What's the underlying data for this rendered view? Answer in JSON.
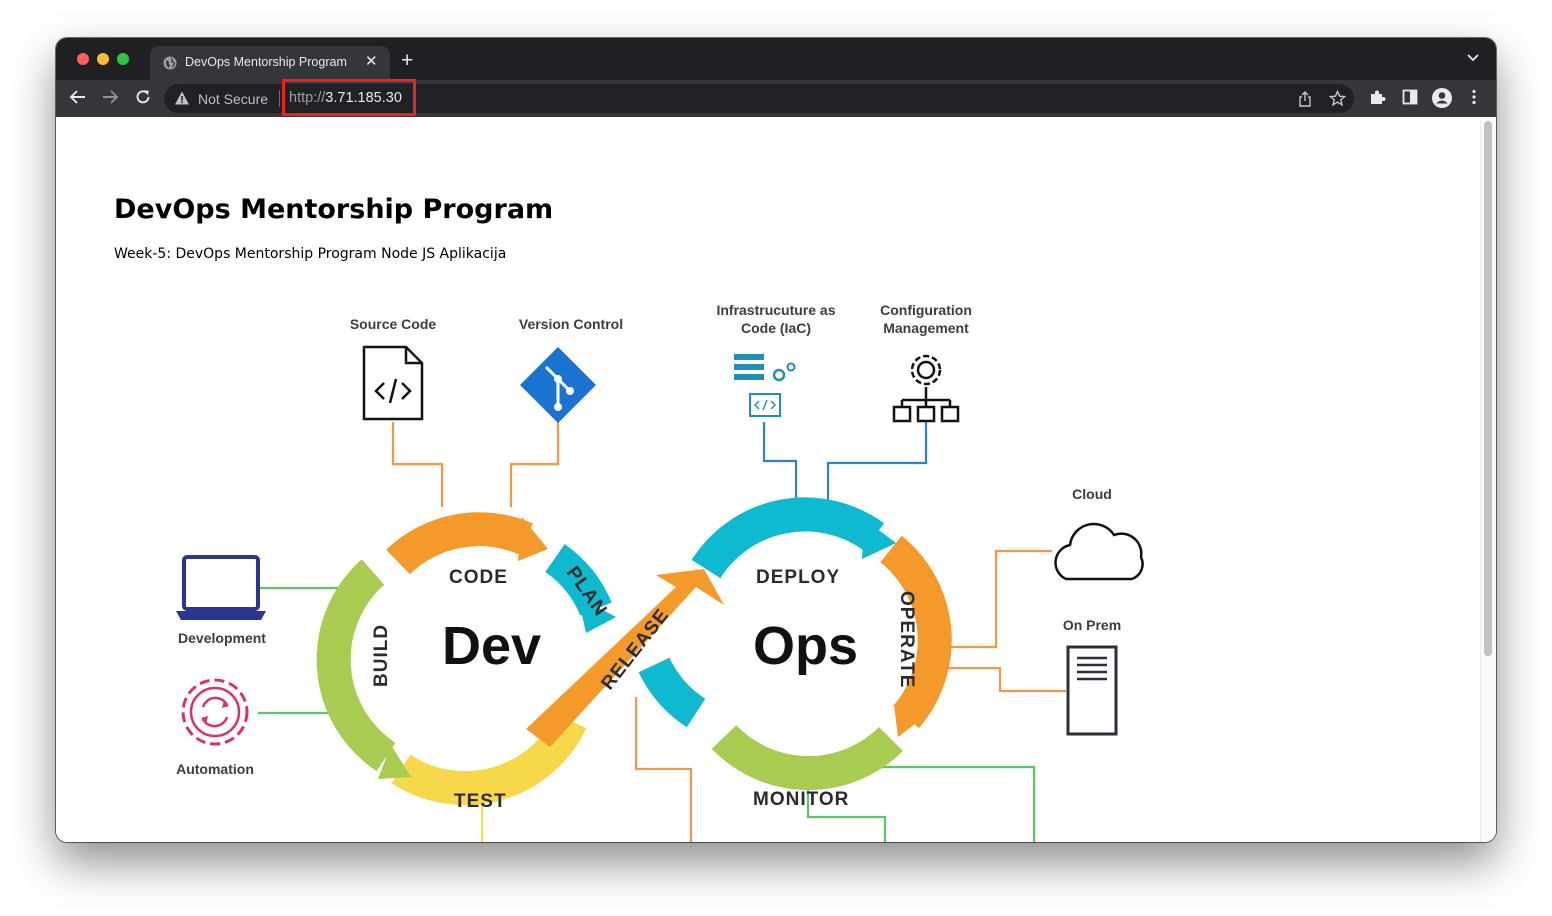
{
  "browser": {
    "tab_title": "DevOps Mentorship Program",
    "tab_close": "✕",
    "new_tab": "+",
    "security_label": "Not Secure",
    "url_scheme": "http://",
    "url_host": "3.71.185.30"
  },
  "page": {
    "title": "DevOps Mentorship Program",
    "subtitle": "Week-5: DevOps Mentorship Program Node JS Aplikacija"
  },
  "diagram": {
    "loop_left": "Dev",
    "loop_right": "Ops",
    "stages": {
      "code": "CODE",
      "plan": "PLAN",
      "build": "BUILD",
      "test": "TEST",
      "release": "RELEASE",
      "deploy": "DEPLOY",
      "operate": "OPERATE",
      "monitor": "MONITOR"
    },
    "labels": {
      "source_code": "Source Code",
      "version_control": "Version Control",
      "iac_line1": "Infrastrucuture as",
      "iac_line2": "Code (IaC)",
      "config_line1": "Configuration",
      "config_line2": "Management",
      "cloud": "Cloud",
      "on_prem": "On Prem",
      "development": "Development",
      "automation": "Automation"
    },
    "colors": {
      "orange": "#f39a2b",
      "teal": "#0fb9cf",
      "green": "#a8cc52",
      "yellow": "#f6d84a",
      "line_orange": "#f0974a",
      "line_blue": "#2f7fd6",
      "line_green": "#5cc46a",
      "line_yellow": "#f4dc55"
    }
  }
}
